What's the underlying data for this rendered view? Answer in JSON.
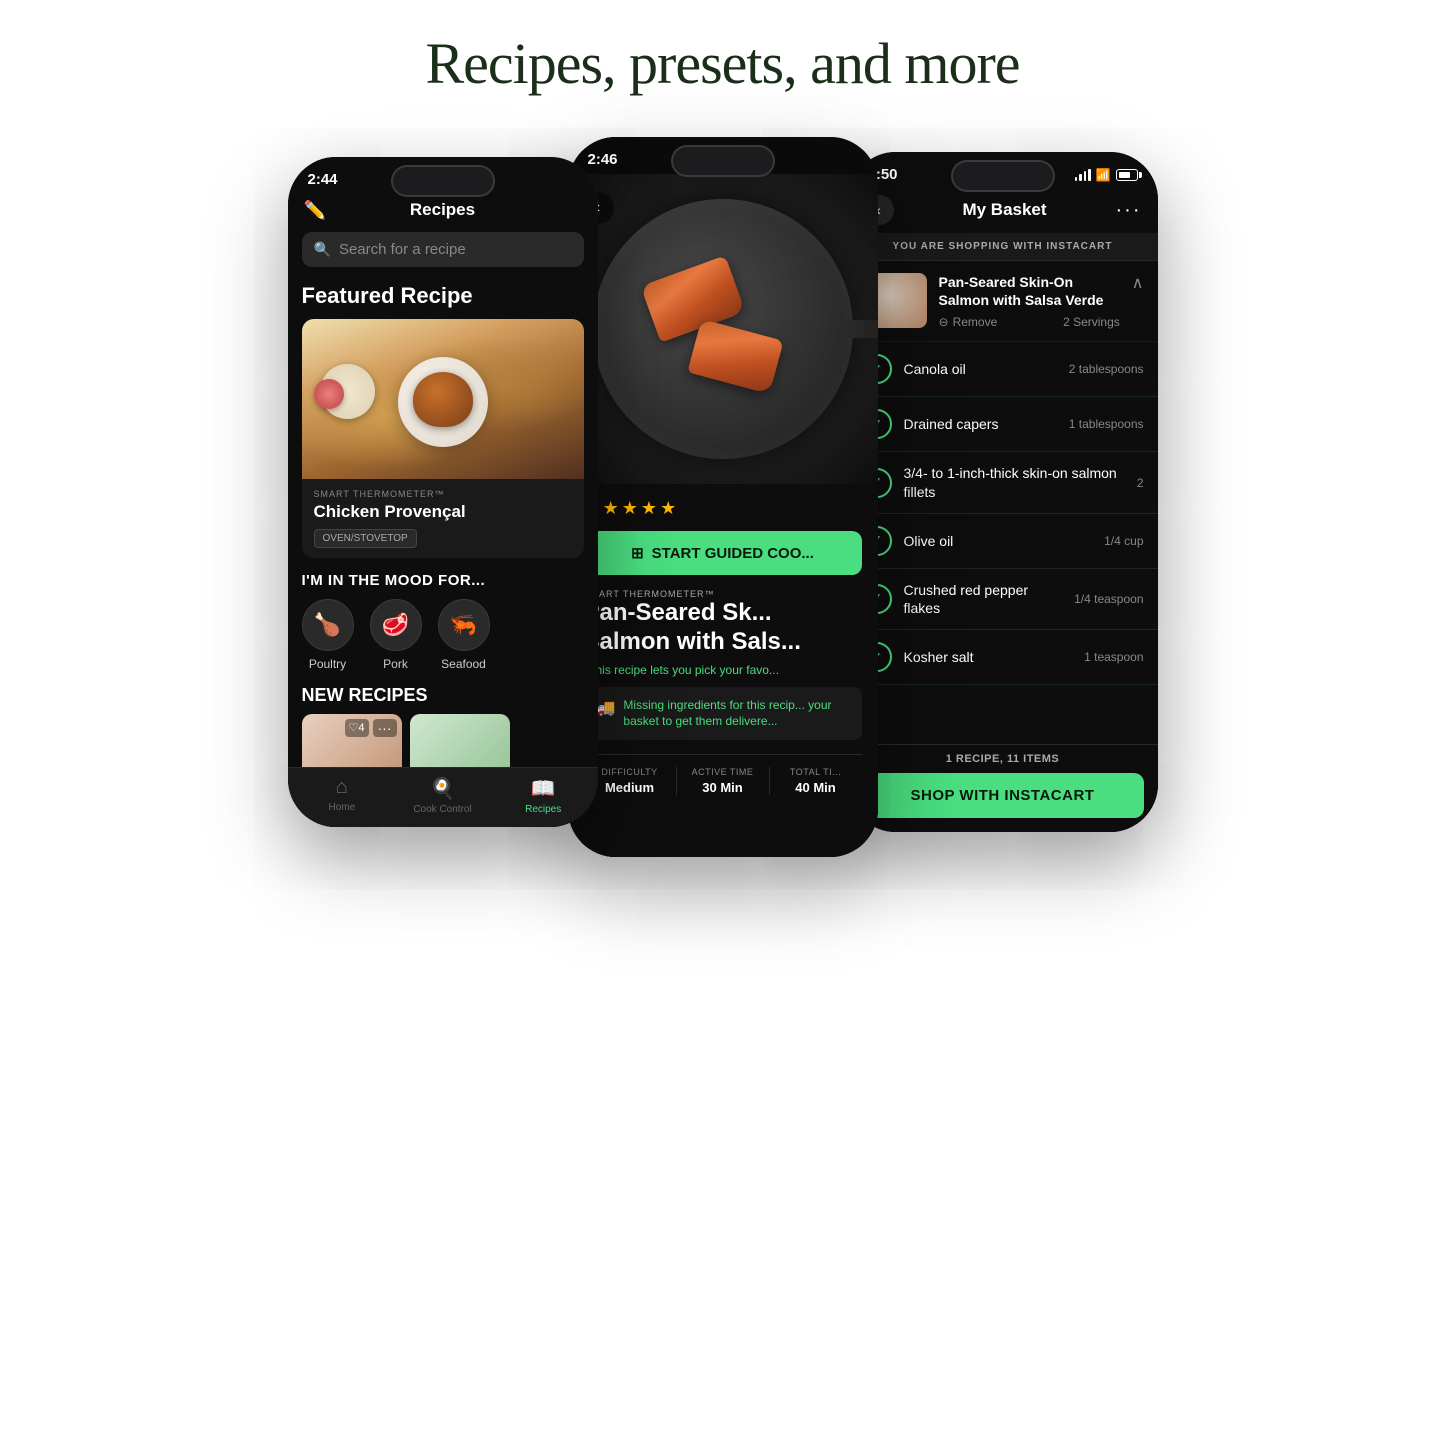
{
  "page": {
    "title": "Recipes, presets, and more"
  },
  "phone1": {
    "status_bar": {
      "time": "2:44"
    },
    "header": {
      "title": "Recipes",
      "edit_icon": "✏️"
    },
    "search": {
      "placeholder": "Search for a recipe"
    },
    "featured": {
      "section_title": "Featured Recipe",
      "smart_thermo": "SMART THERMOMETER™",
      "recipe_name": "Chicken Provençal",
      "tag": "OVEN/STOVETOP"
    },
    "mood": {
      "title": "I'M IN THE MOOD FOR...",
      "items": [
        {
          "icon": "🍗",
          "label": "Poultry"
        },
        {
          "icon": "🥩",
          "label": "Pork"
        },
        {
          "icon": "🦐",
          "label": "Seafood"
        }
      ]
    },
    "new_recipes": {
      "title": "NEW RECIPES"
    },
    "nav": [
      {
        "icon": "🏠",
        "label": "Home",
        "active": false
      },
      {
        "icon": "🍳",
        "label": "Cook Control",
        "active": false
      },
      {
        "icon": "📖",
        "label": "Recipes",
        "active": true
      }
    ]
  },
  "phone2": {
    "status_bar": {
      "time": "2:46"
    },
    "stars": [
      "★",
      "★",
      "★",
      "★",
      "★"
    ],
    "start_btn": "START GUIDED COO...",
    "smart_thermo": "SMART THERMOMETER™",
    "recipe_title_line1": "Pan-Seared Sk...",
    "recipe_title_line2": "Salmon with Sals...",
    "recipe_note": "*This recipe lets you pick your favo...",
    "delivery_text": "Missing ingredients for this recip... your basket to get them delivere...",
    "meta": [
      {
        "label": "DIFFICULTY",
        "value": "Medium"
      },
      {
        "label": "ACTIVE TIME",
        "value": "30 Min"
      },
      {
        "label": "TOTAL TI...",
        "value": "40 Min"
      }
    ]
  },
  "phone3": {
    "status_bar": {
      "time": "2:50"
    },
    "header": {
      "title": "My Basket",
      "dots": "···"
    },
    "instacart_banner": "YOU ARE SHOPPING WITH INSTACART",
    "recipe": {
      "name": "Pan-Seared Skin-On Salmon with Salsa Verde",
      "remove": "Remove",
      "servings": "2 Servings"
    },
    "ingredients": [
      {
        "name": "Canola oil",
        "amount": "2 tablespoons",
        "checked": true
      },
      {
        "name": "Drained capers",
        "amount": "1 tablespoons",
        "checked": true
      },
      {
        "name": "3/4- to 1-inch-thick skin-on salmon fillets",
        "amount": "2",
        "checked": true
      },
      {
        "name": "Olive oil",
        "amount": "1/4 cup",
        "checked": true
      },
      {
        "name": "Crushed red pepper flakes",
        "amount": "1/4 teaspoon",
        "checked": true
      },
      {
        "name": "Kosher salt",
        "amount": "1 teaspoon",
        "checked": true
      }
    ],
    "summary": "1 RECIPE, 11 ITEMS",
    "shop_btn": "SHOP WITH INSTACART"
  }
}
